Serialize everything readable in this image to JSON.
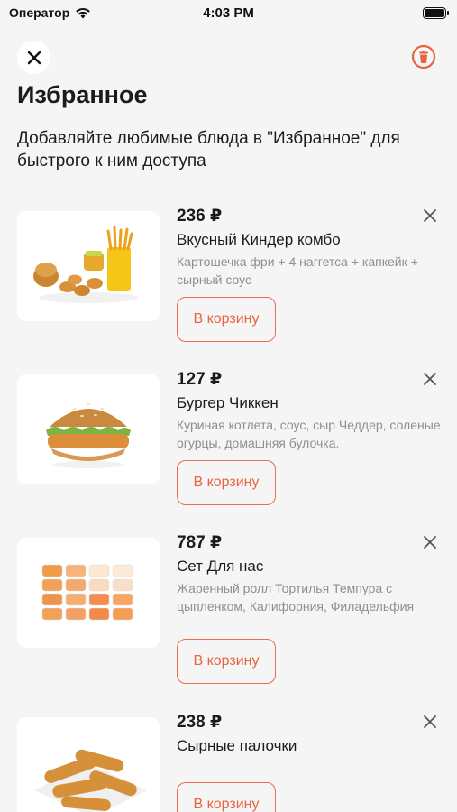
{
  "status": {
    "carrier": "Оператор",
    "time": "4:03 PM"
  },
  "header": {
    "title": "Избранное",
    "subtitle": "Добавляйте любимые блюда в \"Избранное\" для быстрого к ним доступа"
  },
  "colors": {
    "accent": "#e8633f",
    "background": "#f5f5f5",
    "card": "#ffffff",
    "muted_text": "#8f8f8f"
  },
  "icons": {
    "close": "close-icon",
    "trash": "trash-icon",
    "remove": "remove-x-icon",
    "wifi": "wifi-icon",
    "battery": "battery-icon"
  },
  "items": [
    {
      "price": "236 ₽",
      "name": "Вкусный Киндер комбо",
      "description": "Картошечка фри + 4 наггетса + капкейк + сырный соус",
      "button": "В корзину"
    },
    {
      "price": "127 ₽",
      "name": "Бургер Чиккен",
      "description": "Куриная котлета, соус, сыр Чеддер, соленые огурцы, домашняя булочка.",
      "button": "В корзину"
    },
    {
      "price": "787 ₽",
      "name": "Сет Для нас",
      "description": "Жаренный ролл Тортилья Темпура с цыпленком, Калифорния, Филадельфия",
      "button": "В корзину"
    },
    {
      "price": "238 ₽",
      "name": "Сырные палочки",
      "description": "",
      "button": "В корзину"
    }
  ]
}
